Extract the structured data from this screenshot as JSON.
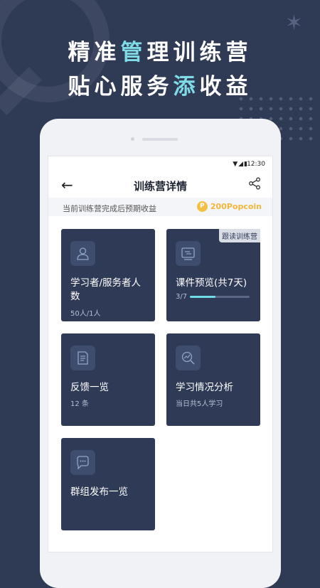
{
  "promo": {
    "line1": [
      {
        "text": "精准",
        "hl": false
      },
      {
        "text": "管",
        "hl": true
      },
      {
        "text": "理训练营",
        "hl": false
      }
    ],
    "line2": [
      {
        "text": "贴心服务",
        "hl": false
      },
      {
        "text": "添",
        "hl": true
      },
      {
        "text": "收益",
        "hl": false
      }
    ],
    "highlight_color": "#7fdbe6",
    "background_color": "#2f3a55"
  },
  "status_bar": {
    "icons": "▼◢▮",
    "time": "12:30"
  },
  "header": {
    "title": "训练营详情",
    "back_icon": "arrow-left-icon",
    "share_icon": "share-icon"
  },
  "earnings": {
    "label": "当前训练营完成后预期收益",
    "coin_symbol": "P",
    "amount": "200Popcoin"
  },
  "cards": [
    {
      "title": "学习者/服务者人数",
      "sub": "50人/1人",
      "icon": "person-icon"
    },
    {
      "title": "课件预览(共7天)",
      "tag": "跟读训练营",
      "progress_text": "3/7",
      "progress": 0.43,
      "icon": "courseware-icon"
    },
    {
      "title": "反馈一览",
      "sub": "12 条",
      "icon": "document-icon"
    },
    {
      "title": "学习情况分析",
      "sub": "当日共5人学习",
      "icon": "analytics-icon"
    },
    {
      "title": "群组发布一览",
      "icon": "chat-bubble-icon"
    }
  ]
}
